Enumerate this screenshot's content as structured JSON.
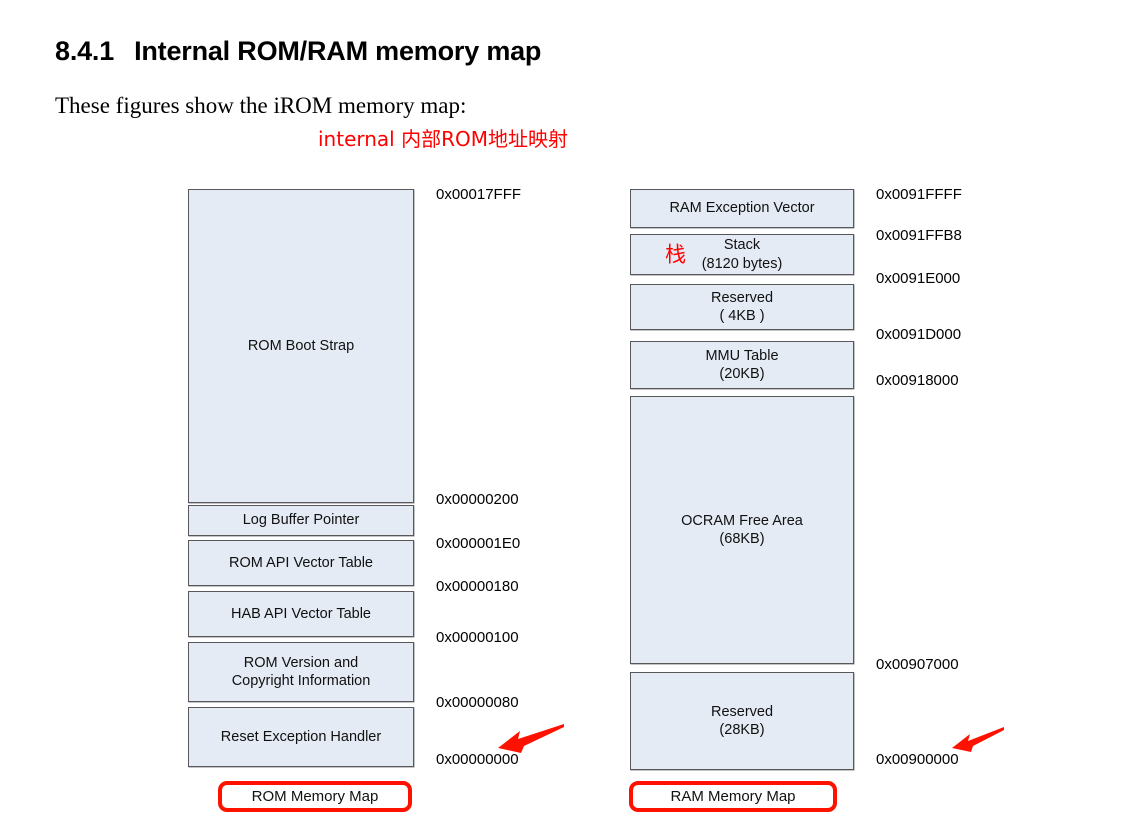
{
  "heading": {
    "number": "8.4.1",
    "title": "Internal ROM/RAM memory map"
  },
  "intro_text": "These figures show the iROM memory map:",
  "annotation_note": "internal 内部ROM地址映射",
  "colors": {
    "box_fill": "#e4ebf5",
    "box_border": "#58585a",
    "annotation_red": "#ff0000",
    "highlight_red": "#ff1100"
  },
  "rom_diagram": {
    "caption": "ROM Memory Map",
    "blocks": [
      {
        "label": "ROM Boot Strap",
        "sub": ""
      },
      {
        "label": "Log Buffer Pointer",
        "sub": ""
      },
      {
        "label": "ROM API Vector Table",
        "sub": ""
      },
      {
        "label": "HAB API Vector Table",
        "sub": ""
      },
      {
        "label": "ROM Version and",
        "sub": "Copyright Information"
      },
      {
        "label": "Reset Exception Handler",
        "sub": ""
      }
    ],
    "addresses": [
      "0x00017FFF",
      "0x00000200",
      "0x000001E0",
      "0x00000180",
      "0x00000100",
      "0x00000080",
      "0x00000000"
    ]
  },
  "ram_diagram": {
    "caption": "RAM Memory Map",
    "blocks": [
      {
        "label": "RAM Exception Vector",
        "sub": ""
      },
      {
        "label": "Stack",
        "sub": "(8120 bytes)",
        "cjk": "栈"
      },
      {
        "label": "Reserved",
        "sub": "( 4KB )"
      },
      {
        "label": "MMU Table",
        "sub": "(20KB)"
      },
      {
        "label": "OCRAM Free Area",
        "sub": "(68KB)"
      },
      {
        "label": "Reserved",
        "sub": "(28KB)"
      }
    ],
    "addresses": [
      "0x0091FFFF",
      "0x0091FFB8",
      "0x0091E000",
      "0x0091D000",
      "0x00918000",
      "0x00907000",
      "0x00900000"
    ]
  }
}
